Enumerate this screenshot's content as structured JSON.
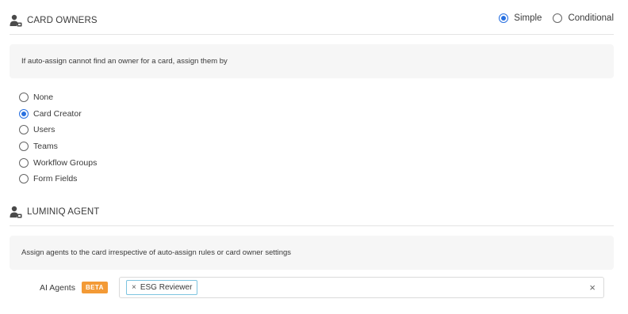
{
  "card_owners": {
    "title": "CARD OWNERS",
    "mode_options": [
      {
        "label": "Simple",
        "checked": true
      },
      {
        "label": "Conditional",
        "checked": false
      }
    ],
    "info_text": "If auto-assign cannot find an owner for a card, assign them by",
    "options": [
      {
        "label": "None",
        "checked": false
      },
      {
        "label": "Card Creator",
        "checked": true
      },
      {
        "label": "Users",
        "checked": false
      },
      {
        "label": "Teams",
        "checked": false
      },
      {
        "label": "Workflow Groups",
        "checked": false
      },
      {
        "label": "Form Fields",
        "checked": false
      }
    ]
  },
  "luminiq_agent": {
    "title": "LUMINIQ AGENT",
    "info_text": "Assign agents to the card irrespective of auto-assign rules or card owner settings",
    "ai_agents_label": "AI Agents",
    "beta_label": "BETA",
    "selected_agents": [
      "ESG Reviewer"
    ],
    "chip_remove_symbol": "×",
    "clear_symbol": "×"
  },
  "colors": {
    "accent": "#2870e0",
    "beta": "#f39a36",
    "chip_border": "#7dc4e0",
    "info_bg": "#f6f6f6"
  },
  "icons": {
    "section_icon": "user-gear-icon"
  }
}
